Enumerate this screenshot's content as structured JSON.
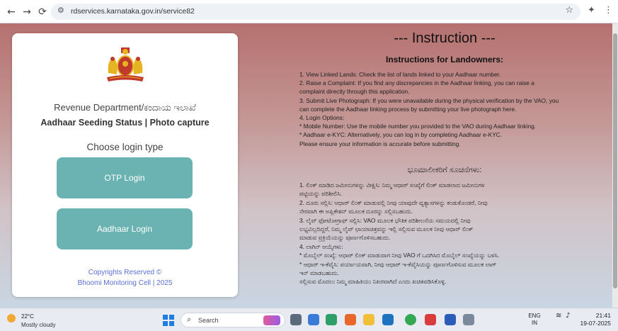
{
  "browser": {
    "url": "rdservices.karnataka.gov.in/service82"
  },
  "card": {
    "department": "Revenue Department/ಕಂದಾಯ ಇಲಾಖೆ",
    "subtitle": "Aadhaar Seeding Status | Photo capture",
    "choose_label": "Choose login type",
    "otp_button": "OTP Login",
    "aadhaar_button": "Aadhaar Login",
    "copyright_line1": "Copyrights Reserved ©",
    "copyright_line2": "Bhoomi Monitoring Cell | 2025"
  },
  "instructions": {
    "title": "--- Instruction ---",
    "subtitle": "Instructions for Landowners:",
    "lines": [
      "1. View Linked Lands: Check the list of lands linked to your Aadhaar number.",
      "2. Raise a Complaint: If you find any discrepancies in the Aadhaar linking, you can raise a",
      "complaint directly through this application.",
      "3. Submit Live Photograph: If you were unavailable during the physical verification by the VAO, you",
      "can complete the Aadhaar linking process by submitting your live photograph here.",
      "4. Login Options:",
      "* Mobile Number: Use the mobile number you provided to the VAO during Aadhaar linking.",
      "* Aadhaar e-KYC: Alternatively, you can log in by completing Aadhaar e-KYC.",
      "Please ensure your information is accurate before submitting."
    ],
    "kannada_title": "ಭೂಮಾಲೀಕರಿಗೆ ಸೂಚನೆಗಳು:",
    "kannada_lines": [
      "1. ಲಿಂಕ್ ಮಾಡಿದ ಜಮೀನುಗಳನ್ನು ವೀಕ್ಷಿಸಿ: ನಿಮ್ಮ ಆಧಾರ್ ಸಂಖ್ಯೆಗೆ ಲಿಂಕ್ ಮಾಡಲಾದ ಜಮೀನುಗಳ",
      "ಪಟ್ಟಿಯನ್ನು ಪರಿಶೀಲಿಸಿ.",
      "2. ದೂರು ಸಲ್ಲಿಸಿ: ಆಧಾರ್ ಲಿಂಕ್ ಮಾಡುವಲ್ಲಿ ನೀವು ಯಾವುದೇ ವ್ಯತ್ಯಾಸಗಳನ್ನು ಕಂಡುಕೊಂಡರೆ, ನೀವು",
      "ನೇರವಾಗಿ ಈ ಅಪ್ಲಿಕೇಶನ್ ಮೂಲಕ ದೂರನ್ನು ಸಲ್ಲಿಸಬಹುದು.",
      "3. ಲೈವ್ ಫೋಟೋಗ್ರಾಫ್ ಸಲ್ಲಿಸಿ: VAO ಮೂಲಕ ಭೌತಿಕ ಪರಿಶೀಲನೆಯ ಸಮಯದಲ್ಲಿ ನೀವು",
      "ಲಭ್ಯವಿಲ್ಲದಿದ್ದರೆ, ನಿಮ್ಮ ಲೈವ್ ಛಾಯಾಚಿತ್ರವನ್ನು ಇಲ್ಲಿ ಸಲ್ಲಿಸುವ ಮೂಲಕ ನೀವು ಆಧಾರ್ ಲಿಂಕ್",
      "ಮಾಡುವ ಪ್ರಕ್ರಿಯೆಯನ್ನು ಪೂರ್ಣಗೊಳಿಸಬಹುದು.",
      "4. ಲಾಗಿನ್ ಆಯ್ಕೆಗಳು:",
      "* ಮೊಬೈಲ್ ಸಂಖ್ಯೆ: ಆಧಾರ್ ಲಿಂಕ್ ಮಾಡುವಾಗ ನೀವು VAO ಗೆ ಒದಗಿಸಿದ ಮೊಬೈಲ್ ಸಂಖ್ಯೆಯನ್ನು ಬಳಸಿ.",
      "* ಆಧಾರ್ ಇ-ಕೆವೈಸಿ: ಪರ್ಯಾಯವಾಗಿ, ನೀವು ಆಧಾರ್ ಇ-ಕೆವೈಸಿಯನ್ನು ಪೂರ್ಣಗೊಳಿಸುವ ಮೂಲಕ ಲಾಗ್",
      "ಇನ್ ಮಾಡಬಹುದು.",
      "ಸಲ್ಲಿಸುವ ಮೊದಲು ನಿಮ್ಮ ಮಾಹಿತಿಯು ನಿಖರವಾಗಿದೆ ಎಂದು ಖಚಿತಪಡಿಸಿಕೊಳ್ಳಿ."
    ]
  },
  "taskbar": {
    "temperature": "22°C",
    "weather": "Mostly cloudy",
    "search_placeholder": "Search",
    "lang_top": "ENG",
    "lang_bottom": "IN",
    "time": "21:41",
    "date": "19-07-2025"
  },
  "colors": {
    "button": "#6ab3b2",
    "link": "#5a6fd1"
  }
}
